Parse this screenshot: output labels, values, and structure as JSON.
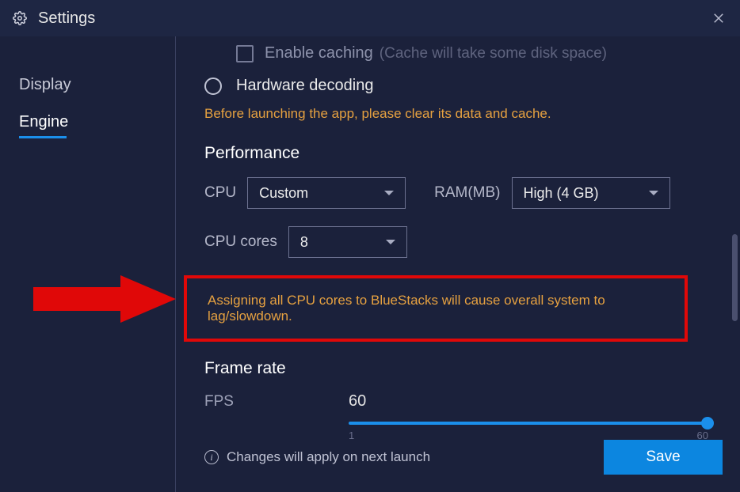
{
  "titlebar": {
    "title": "Settings"
  },
  "sidebar": {
    "items": [
      {
        "label": "Display",
        "active": false
      },
      {
        "label": "Engine",
        "active": true
      }
    ]
  },
  "caching": {
    "label": "Enable caching",
    "hint": "(Cache will take some disk space)"
  },
  "decoding": {
    "label": "Hardware decoding"
  },
  "pre_warn": "Before launching the app, please clear its data and cache.",
  "performance": {
    "heading": "Performance",
    "cpu_label": "CPU",
    "cpu_value": "Custom",
    "ram_label": "RAM(MB)",
    "ram_value": "High (4 GB)",
    "cores_label": "CPU cores",
    "cores_value": "8"
  },
  "core_warning": "Assigning all CPU cores to BlueStacks will cause overall system to lag/slowdown.",
  "frame": {
    "heading": "Frame rate",
    "fps_label": "FPS",
    "fps_value": "60",
    "min": "1",
    "max": "60"
  },
  "footer": {
    "note": "Changes will apply on next launch",
    "save": "Save"
  }
}
